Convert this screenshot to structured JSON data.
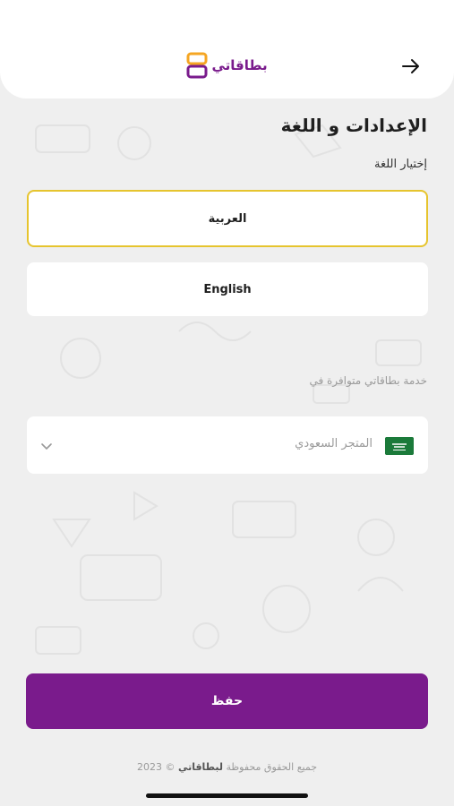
{
  "header": {
    "brand_name": "بطاقاتي",
    "back_icon": "arrow-right-icon"
  },
  "settings": {
    "title": "الإعدادات و اللغة",
    "language_label": "إختيار اللغة",
    "languages": [
      {
        "label": "العربية",
        "selected": true
      },
      {
        "label": "English",
        "selected": false
      }
    ],
    "store_label": "خدمة بطاقاتي متوافرة في",
    "store_value": "المتجر السعودي",
    "store_icon": "saudi-flag-icon"
  },
  "actions": {
    "save_label": "حفظ"
  },
  "footer": {
    "prefix": "جميع الحقوق محفوظة",
    "brand": "لبطاقاتي",
    "suffix": "© 2023"
  },
  "colors": {
    "primary": "#7a1b8c",
    "selected_border": "#e6c42e",
    "accent_orange": "#f5a623"
  }
}
